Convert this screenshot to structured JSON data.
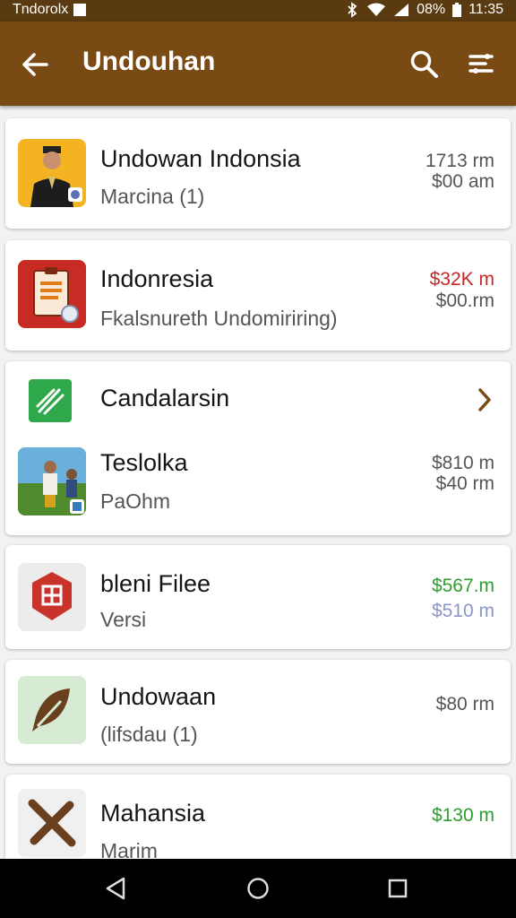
{
  "status_bar": {
    "carrier": "Tndorolx",
    "battery": "08%",
    "time": "11:35"
  },
  "app_bar": {
    "title": "Undouhan"
  },
  "items": [
    {
      "name": "Undowan Indonsia",
      "subtitle": "Marcina (1)",
      "price_1": "1713 rm",
      "price_2": "$00 am"
    },
    {
      "name": "Indonresia",
      "subtitle": "Fkalsnureth Undomiriring)",
      "price_1": "$32K m",
      "price_2": "$00.rm",
      "price_1_color": "#c62828"
    },
    {
      "name": "Candalarsin"
    },
    {
      "name": "Teslolka",
      "subtitle": "PaOhm",
      "price_1": "$810 m",
      "price_2": "$40 rm"
    },
    {
      "name": "bleni Filee",
      "subtitle": "Versi",
      "price_1": "$567.m",
      "price_2": "$510 m",
      "price_1_color": "#2e9e2e",
      "price_2_color": "#8a96c8"
    },
    {
      "name": "Undowaan",
      "subtitle": "(lifsdau (1)",
      "price_1": "$80 rm"
    },
    {
      "name": "Mahansia",
      "subtitle": "Marim",
      "price_1": "$130 m",
      "price_1_color": "#2e9e2e"
    }
  ],
  "icons": {
    "back": "arrow-left-icon",
    "search": "search-icon",
    "filter": "filter-icon",
    "chevron": "chevron-right-icon",
    "nav_back": "triangle-back-icon",
    "nav_home": "circle-home-icon",
    "nav_recents": "square-recents-icon"
  },
  "colors": {
    "app_bar": "#7a4a14",
    "status_bar": "#5a3a10",
    "price_red": "#c62828",
    "price_green": "#2e9e2e"
  }
}
